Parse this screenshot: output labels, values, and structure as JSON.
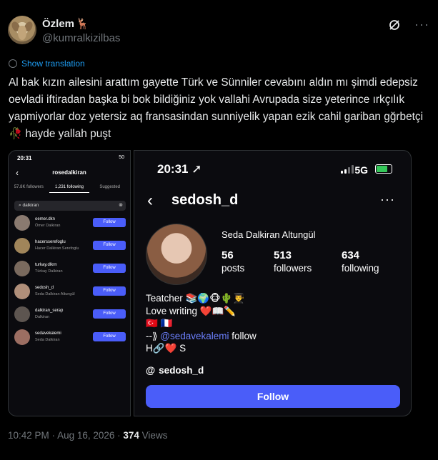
{
  "author": {
    "display_name": "Özlem",
    "name_emoji": "🦌",
    "handle": "@kumralkizilbas"
  },
  "header_icons": {
    "grok": "grok-icon",
    "more": "more-icon"
  },
  "show_translation": "Show translation",
  "tweet_text": "Al bak kızın ailesini arattım gayette Türk ve Sünniler cevabını aldın mı şimdi edepsiz oevladi iftiradan başka bi bok bildiğiniz yok vallahi Avrupada size yeterince ırkçılık yapmiyorlar doz yetersiz aq fransasindan sunniyelik yapan ezik cahil gariban gğrbetçi 🥀 hayde yallah puşt",
  "left_screenshot": {
    "status_time": "20:31",
    "status_right": "50",
    "title": "rosedalkiran",
    "tabs": [
      "57.8K followers",
      "1,231 following",
      "Suggested"
    ],
    "search_value": "dalkiran",
    "rows": [
      {
        "username": "oemer.dkn",
        "fullname": "Ömer Dalkiran",
        "button": "Follow"
      },
      {
        "username": "hacersserefoglu",
        "fullname": "Hacer Dalkiran Serefoglu",
        "button": "Follow"
      },
      {
        "username": "turkay.dlkrn",
        "fullname": "Türkay Dalkiran",
        "button": "Follow"
      },
      {
        "username": "sedosh_d",
        "fullname": "Seda Dalkiran Altungül",
        "button": "Follow"
      },
      {
        "username": "dalkiran_serap",
        "fullname": "Dalkiran",
        "button": "Follow"
      },
      {
        "username": "sedavekalemi",
        "fullname": "Seda Dalkiran",
        "button": "Follow"
      }
    ]
  },
  "right_screenshot": {
    "status_time": "20:31",
    "network": "5G",
    "battery_level": 0.7,
    "username": "sedosh_d",
    "full_name": "Seda Dalkiran Altungül",
    "posts_count": "56",
    "posts_label": "posts",
    "followers_count": "513",
    "followers_label": "followers",
    "following_count": "634",
    "following_label": "following",
    "bio_line1": "Teatcher 📚🌍🐵🌵👨‍🎓",
    "bio_line2": "Love writing ❤️📖✏️",
    "bio_line3": "🇹🇷 🇫🇷",
    "bio_line4_prefix": "--⟫ ",
    "bio_line4_mention": "@sedavekalemi",
    "bio_line4_suffix": " follow",
    "bio_line5": "H🔗❤️ S",
    "threads_handle": "sedosh_d",
    "follow_button": "Follow"
  },
  "meta": {
    "time": "10:42 PM",
    "separator": " · ",
    "date": "Aug 16, 2026",
    "views_count": "374",
    "views_label": " Views"
  }
}
